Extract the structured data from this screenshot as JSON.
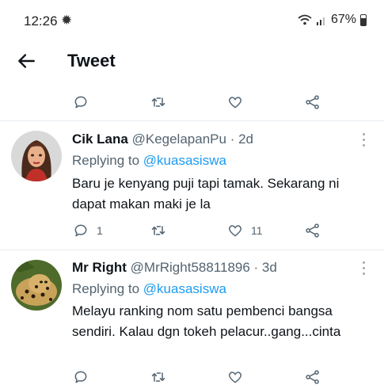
{
  "status_bar": {
    "time": "12:26",
    "battery": "67%",
    "icons": [
      "sun-icon",
      "wifi-icon",
      "signal-icon",
      "battery-icon"
    ]
  },
  "header": {
    "title": "Tweet"
  },
  "top_actions": {
    "reply_count": "",
    "retweet_count": "",
    "like_count": ""
  },
  "tweets": [
    {
      "name": "Cik Lana",
      "handle": "@KegelapanPu",
      "time": "· 2d",
      "replying_prefix": "Replying to",
      "replying_to": "@kuasasiswa",
      "text": "Baru je kenyang puji tapi tamak. Sekarang ni dapat makan maki je la",
      "reply_count": "1",
      "retweet_count": "",
      "like_count": "11"
    },
    {
      "name": "Mr Right",
      "handle": "@MrRight58811896",
      "time": "· 3d",
      "replying_prefix": "Replying to",
      "replying_to": "@kuasasiswa",
      "text": "Melayu ranking nom satu pembenci bangsa sendiri. Kalau dgn tokeh pelacur..gang...cinta",
      "reply_count": "",
      "retweet_count": "",
      "like_count": ""
    }
  ],
  "colors": {
    "accent": "#1d9bf0",
    "muted": "#536471",
    "text": "#0f1419",
    "divider": "#e6ecf0"
  }
}
